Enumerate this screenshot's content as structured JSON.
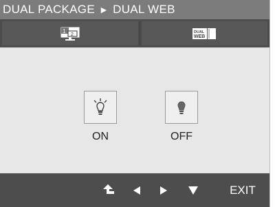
{
  "title": {
    "section": "DUAL PACKAGE",
    "separator": "►",
    "page": "DUAL WEB"
  },
  "tabs": [
    {
      "icon": "dual-screen-icon",
      "selected": true
    },
    {
      "icon": "dual-web-icon",
      "icon_text": "DUAL WEB",
      "selected": false
    }
  ],
  "options": {
    "on": {
      "label": "ON",
      "icon": "lightbulb-on-icon"
    },
    "off": {
      "label": "OFF",
      "icon": "lightbulb-off-icon"
    }
  },
  "nav": {
    "up": "up-arrow-icon",
    "left": "left-arrow-icon",
    "right": "right-arrow-icon",
    "down": "down-arrow-icon",
    "exit_label": "EXIT"
  },
  "colors": {
    "title_bar": "#7c7c7c",
    "bars": "#4d4d4d",
    "panel": "#e7e7e7"
  }
}
